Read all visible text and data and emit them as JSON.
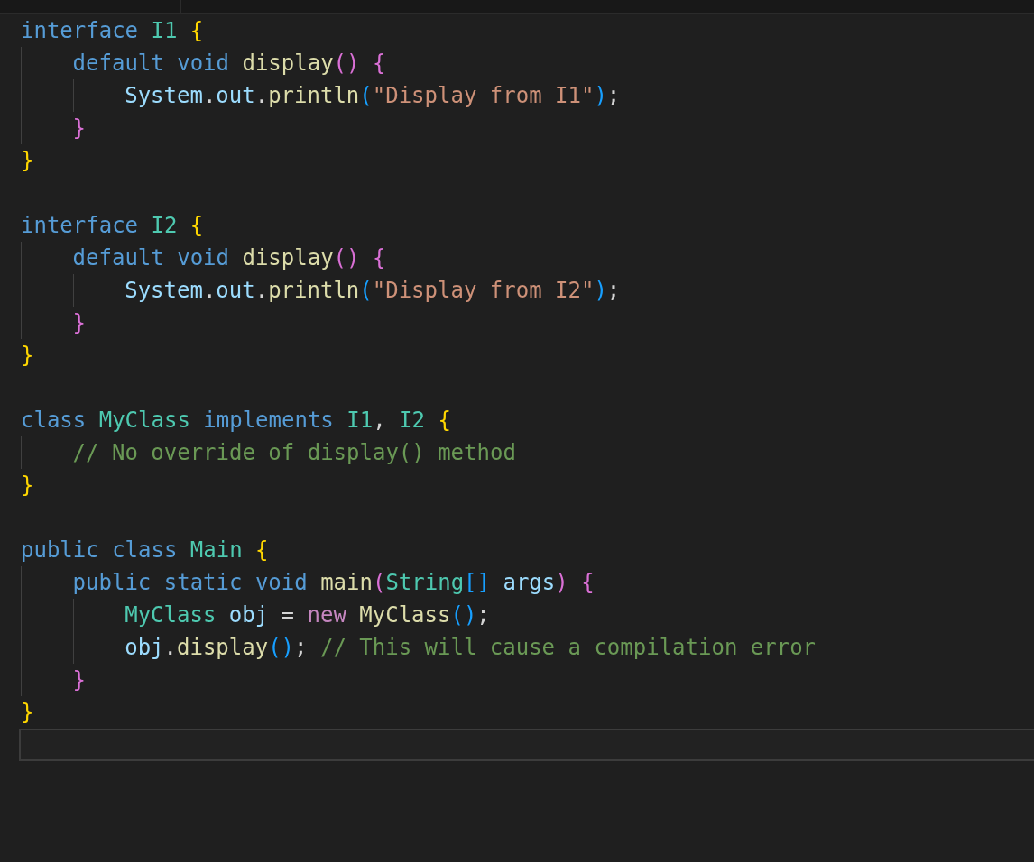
{
  "editor": {
    "lines": [
      {
        "current": false,
        "tokens": [
          {
            "kind": "kw",
            "text": "interface "
          },
          {
            "kind": "type",
            "text": "I1 "
          },
          {
            "kind": "b1",
            "text": "{"
          }
        ]
      },
      {
        "current": false,
        "tokens": [
          {
            "kind": "indent"
          },
          {
            "kind": "kw",
            "text": "default void "
          },
          {
            "kind": "fn",
            "text": "display"
          },
          {
            "kind": "b2",
            "text": "() {"
          }
        ]
      },
      {
        "current": false,
        "tokens": [
          {
            "kind": "indent"
          },
          {
            "kind": "indent"
          },
          {
            "kind": "var",
            "text": "System"
          },
          {
            "kind": "punc",
            "text": "."
          },
          {
            "kind": "var",
            "text": "out"
          },
          {
            "kind": "punc",
            "text": "."
          },
          {
            "kind": "fn",
            "text": "println"
          },
          {
            "kind": "b3",
            "text": "("
          },
          {
            "kind": "str",
            "text": "\"Display from I1\""
          },
          {
            "kind": "b3",
            "text": ")"
          },
          {
            "kind": "punc",
            "text": ";"
          }
        ]
      },
      {
        "current": false,
        "tokens": [
          {
            "kind": "indent"
          },
          {
            "kind": "b2",
            "text": "}"
          }
        ]
      },
      {
        "current": false,
        "tokens": [
          {
            "kind": "b1",
            "text": "}"
          }
        ]
      },
      {
        "current": false
      },
      {
        "current": false,
        "tokens": [
          {
            "kind": "kw",
            "text": "interface "
          },
          {
            "kind": "type",
            "text": "I2 "
          },
          {
            "kind": "b1",
            "text": "{"
          }
        ]
      },
      {
        "current": false,
        "tokens": [
          {
            "kind": "indent"
          },
          {
            "kind": "kw",
            "text": "default void "
          },
          {
            "kind": "fn",
            "text": "display"
          },
          {
            "kind": "b2",
            "text": "() {"
          }
        ]
      },
      {
        "current": false,
        "tokens": [
          {
            "kind": "indent"
          },
          {
            "kind": "indent"
          },
          {
            "kind": "var",
            "text": "System"
          },
          {
            "kind": "punc",
            "text": "."
          },
          {
            "kind": "var",
            "text": "out"
          },
          {
            "kind": "punc",
            "text": "."
          },
          {
            "kind": "fn",
            "text": "println"
          },
          {
            "kind": "b3",
            "text": "("
          },
          {
            "kind": "str",
            "text": "\"Display from I2\""
          },
          {
            "kind": "b3",
            "text": ")"
          },
          {
            "kind": "punc",
            "text": ";"
          }
        ]
      },
      {
        "current": false,
        "tokens": [
          {
            "kind": "indent"
          },
          {
            "kind": "b2",
            "text": "}"
          }
        ]
      },
      {
        "current": false,
        "tokens": [
          {
            "kind": "b1",
            "text": "}"
          }
        ]
      },
      {
        "current": false
      },
      {
        "current": false,
        "tokens": [
          {
            "kind": "kw",
            "text": "class "
          },
          {
            "kind": "type",
            "text": "MyClass "
          },
          {
            "kind": "kw",
            "text": "implements "
          },
          {
            "kind": "type",
            "text": "I1"
          },
          {
            "kind": "punc",
            "text": ", "
          },
          {
            "kind": "type",
            "text": "I2 "
          },
          {
            "kind": "b1",
            "text": "{"
          }
        ]
      },
      {
        "current": false,
        "tokens": [
          {
            "kind": "indent"
          },
          {
            "kind": "com",
            "text": "// No override of display() method"
          }
        ]
      },
      {
        "current": false,
        "tokens": [
          {
            "kind": "b1",
            "text": "}"
          }
        ]
      },
      {
        "current": false
      },
      {
        "current": false,
        "tokens": [
          {
            "kind": "kw",
            "text": "public class "
          },
          {
            "kind": "type",
            "text": "Main "
          },
          {
            "kind": "b1",
            "text": "{"
          }
        ]
      },
      {
        "current": false,
        "tokens": [
          {
            "kind": "indent"
          },
          {
            "kind": "kw",
            "text": "public static void "
          },
          {
            "kind": "fn",
            "text": "main"
          },
          {
            "kind": "b2",
            "text": "("
          },
          {
            "kind": "type",
            "text": "String"
          },
          {
            "kind": "b3",
            "text": "[] "
          },
          {
            "kind": "var",
            "text": "args"
          },
          {
            "kind": "b2",
            "text": ") {"
          }
        ]
      },
      {
        "current": false,
        "tokens": [
          {
            "kind": "indent"
          },
          {
            "kind": "indent"
          },
          {
            "kind": "type",
            "text": "MyClass "
          },
          {
            "kind": "var",
            "text": "obj "
          },
          {
            "kind": "punc",
            "text": "= "
          },
          {
            "kind": "ctl",
            "text": "new "
          },
          {
            "kind": "fn",
            "text": "MyClass"
          },
          {
            "kind": "b3",
            "text": "()"
          },
          {
            "kind": "punc",
            "text": ";"
          }
        ]
      },
      {
        "current": false,
        "tokens": [
          {
            "kind": "indent"
          },
          {
            "kind": "indent"
          },
          {
            "kind": "var",
            "text": "obj"
          },
          {
            "kind": "punc",
            "text": "."
          },
          {
            "kind": "fn",
            "text": "display"
          },
          {
            "kind": "b3",
            "text": "()"
          },
          {
            "kind": "punc",
            "text": "; "
          },
          {
            "kind": "com",
            "text": "// This will cause a compilation error"
          }
        ]
      },
      {
        "current": false,
        "tokens": [
          {
            "kind": "indent"
          },
          {
            "kind": "b2",
            "text": "}"
          }
        ]
      },
      {
        "current": false,
        "tokens": [
          {
            "kind": "b1",
            "text": "}"
          }
        ]
      },
      {
        "current": true
      }
    ]
  }
}
